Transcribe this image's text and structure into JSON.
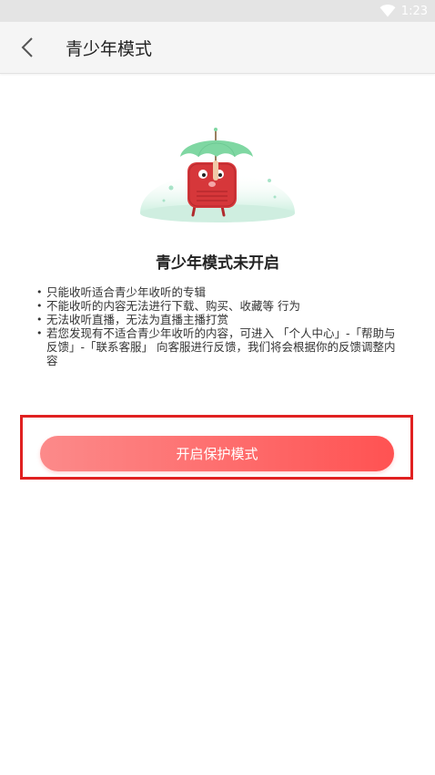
{
  "status_bar": {
    "time": "1:23",
    "icons": [
      "wifi-icon"
    ]
  },
  "header": {
    "back_icon": "chevron-left-icon",
    "title": "青少年模式"
  },
  "main": {
    "illustration": "umbrella-mascot-illustration",
    "heading": "青少年模式未开启",
    "rules": [
      "只能收听适合青少年收听的专辑",
      "不能收听的内容无法进行下载、购买、收藏等 行为",
      "无法收听直播，无法为直播主播打赏",
      "若您发现有不适合青少年收听的内容，可进入 「个人中心」-「帮助与反馈」-「联系客服」 向客服进行反馈，我们将会根据你的反馈调整内容"
    ],
    "enable_button_label": "开启保护模式"
  },
  "colors": {
    "accent": "#ff5a5a",
    "highlight_border": "#e02121",
    "mascot_red": "#d6373a",
    "umbrella_green": "#7fd7a2"
  }
}
